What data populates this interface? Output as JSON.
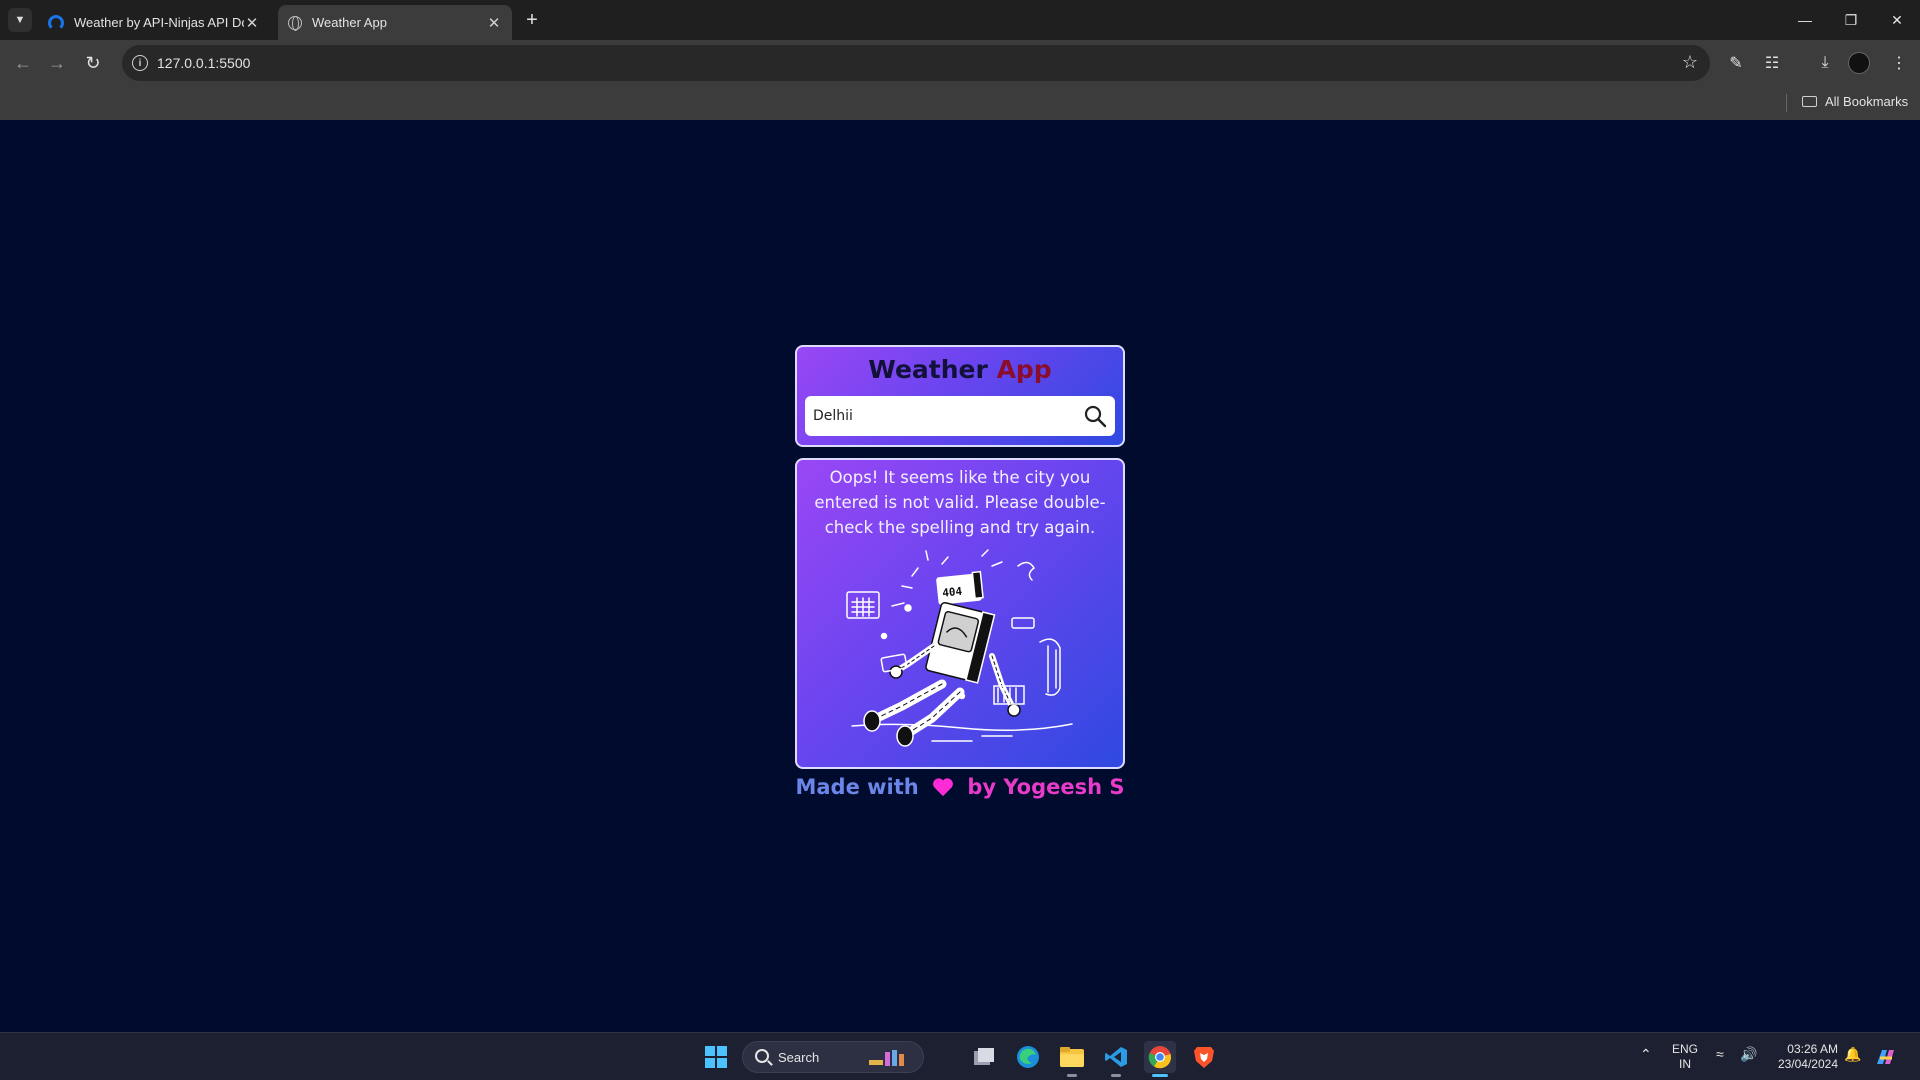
{
  "browser": {
    "tabs": [
      {
        "title": "Weather by API-Ninjas API Do",
        "active": false
      },
      {
        "title": "Weather App",
        "active": true
      }
    ],
    "url": "127.0.0.1:5500",
    "bookmarks_label": "All Bookmarks"
  },
  "app": {
    "title_part1": "Weather",
    "title_part2": "App",
    "search_value": "Delhii",
    "error_message": "Oops! It seems like the city you entered is not valid. Please double-check the spelling and try again.",
    "illustration_label": "404",
    "footer_made": "Made with",
    "footer_by": "by Yogeesh S"
  },
  "taskbar": {
    "search_label": "Search",
    "lang_line1": "ENG",
    "lang_line2": "IN",
    "time": "03:26 AM",
    "date": "23/04/2024"
  },
  "colors": {
    "page_background": "#000b2e",
    "card_gradient_start": "#9a47f5",
    "card_gradient_end": "#2f49e0",
    "title_dark": "#12113a",
    "title_accent": "#8b0d2e",
    "footer_blue": "#6b86e8",
    "footer_pink": "#e93bc9",
    "heart": "#ff2bd6"
  }
}
